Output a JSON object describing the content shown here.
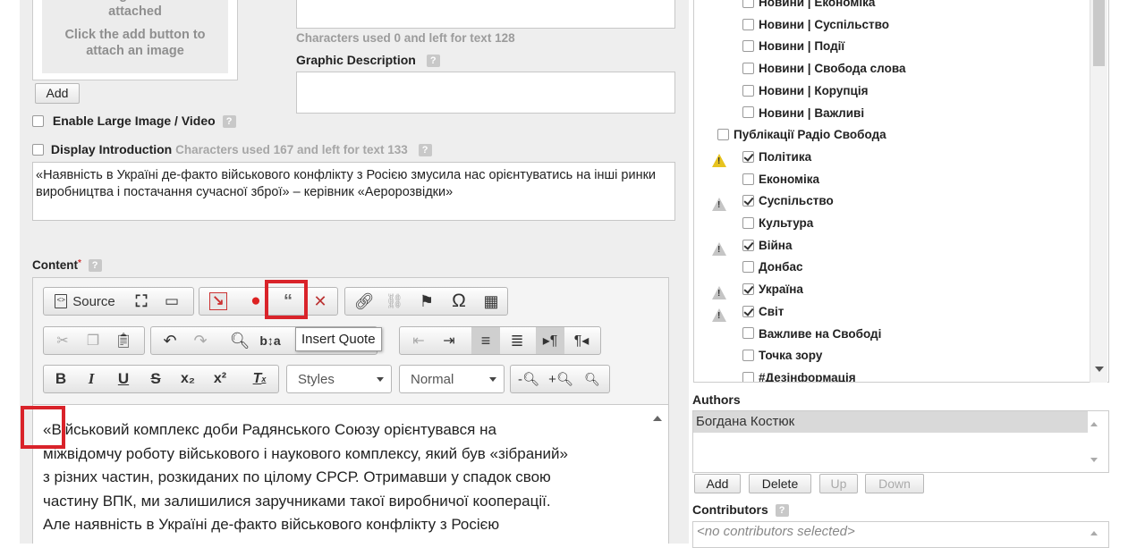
{
  "image_panel": {
    "no_image_text": "No image has been attached",
    "hint": "Click the add button to attach an image",
    "add_button": "Add"
  },
  "options": {
    "enable_large": "Enable Large Image / Video",
    "display_intro": "Display Introduction",
    "intro_counter": "Characters used 167 and left for text 133"
  },
  "fields": {
    "counter_top": "Characters used 0 and left for text 128",
    "graphic_description_label": "Graphic Description"
  },
  "introduction_text": "«Наявність в Україні де-факто військового конфлікту з Росією змусила нас орієнтуватись на інші ринки виробництва і постачання сучасної зброї» – керівник «Аеророзвідки»",
  "content_label": "Content",
  "toolbar": {
    "source_label": "Source",
    "tooltip": "Insert Quote",
    "styles_label": "Styles",
    "format_label": "Normal"
  },
  "content_lines": [
    "«Військовий комплекс доби Радянського Союзу орієнтувався на",
    "міжвідомчу роботу військового і наукового комплексу, який був «зібраний»",
    "з різних частин, розкиданих по цілому СРСР. Отримавши у спадок свою",
    "частину ВПК, ми залишилися заручниками такої виробничої кооперації.",
    "Але наявність в Україні де-факто військового конфлікту з Росією"
  ],
  "categories": [
    {
      "label": "Новини | Економіка",
      "checked": false,
      "warn": "",
      "indent": 1
    },
    {
      "label": "Новини | Суспільство",
      "checked": false,
      "warn": "",
      "indent": 1
    },
    {
      "label": "Новини | Події",
      "checked": false,
      "warn": "",
      "indent": 1
    },
    {
      "label": "Новини | Свобода слова",
      "checked": false,
      "warn": "",
      "indent": 1
    },
    {
      "label": "Новини | Корупція",
      "checked": false,
      "warn": "",
      "indent": 1
    },
    {
      "label": "Новини | Важливі",
      "checked": false,
      "warn": "",
      "indent": 1
    },
    {
      "label": "Публікації Радіо Свобода",
      "checked": false,
      "warn": "",
      "indent": 0
    },
    {
      "label": "Політика",
      "checked": true,
      "warn": "yellow",
      "indent": 1
    },
    {
      "label": "Економіка",
      "checked": false,
      "warn": "",
      "indent": 1
    },
    {
      "label": "Суспільство",
      "checked": true,
      "warn": "gray",
      "indent": 1
    },
    {
      "label": "Культура",
      "checked": false,
      "warn": "",
      "indent": 1
    },
    {
      "label": "Війна",
      "checked": true,
      "warn": "gray",
      "indent": 1
    },
    {
      "label": "Донбас",
      "checked": false,
      "warn": "",
      "indent": 1
    },
    {
      "label": "Україна",
      "checked": true,
      "warn": "gray",
      "indent": 1
    },
    {
      "label": "Світ",
      "checked": true,
      "warn": "gray",
      "indent": 1
    },
    {
      "label": "Важливе на Свободі",
      "checked": false,
      "warn": "",
      "indent": 1
    },
    {
      "label": "Точка зору",
      "checked": false,
      "warn": "",
      "indent": 1
    },
    {
      "label": "#Дезінформація",
      "checked": false,
      "warn": "",
      "indent": 1
    }
  ],
  "authors": {
    "label": "Authors",
    "selected": "Богдана Костюк",
    "buttons": [
      "Add",
      "Delete",
      "Up",
      "Down"
    ]
  },
  "contributors": {
    "label": "Contributors",
    "placeholder": "<no contributors selected>"
  }
}
